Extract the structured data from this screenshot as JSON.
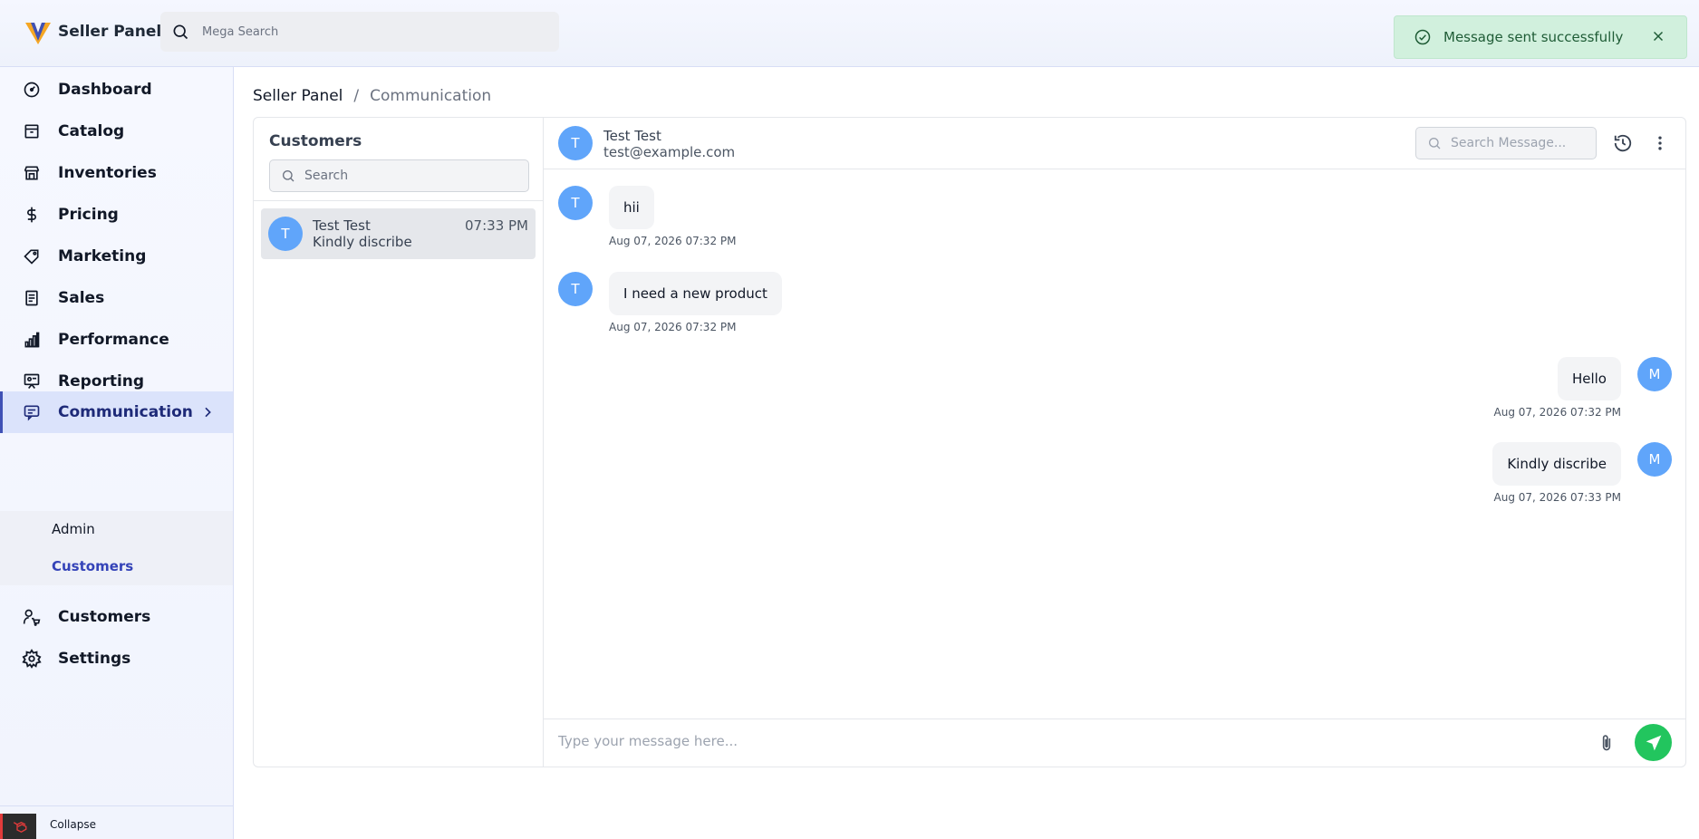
{
  "brand": {
    "name": "Seller Panel",
    "icon": "v-logo-icon"
  },
  "topbar": {
    "search_placeholder": "Mega Search",
    "search_icon": "search-icon"
  },
  "toast": {
    "message": "Message sent successfully",
    "icon": "check-circle-icon",
    "close_icon": "close-icon",
    "color": "#d1f0dd"
  },
  "sidebar": {
    "items": [
      {
        "label": "Dashboard",
        "icon": "gauge-icon"
      },
      {
        "label": "Catalog",
        "icon": "archive-box-icon"
      },
      {
        "label": "Inventories",
        "icon": "warehouse-icon"
      },
      {
        "label": "Pricing",
        "icon": "dollar-icon"
      },
      {
        "label": "Marketing",
        "icon": "tag-icon"
      },
      {
        "label": "Sales",
        "icon": "receipt-icon"
      },
      {
        "label": "Performance",
        "icon": "bar-chart-icon"
      },
      {
        "label": "Reporting",
        "icon": "presentation-icon"
      },
      {
        "label": "Communication",
        "icon": "chat-icon",
        "active": true
      },
      {
        "label": "Customers",
        "icon": "user-cart-icon"
      },
      {
        "label": "Settings",
        "icon": "gear-icon"
      }
    ],
    "submenu": [
      {
        "label": "Admin"
      },
      {
        "label": "Customers",
        "active": true
      }
    ],
    "collapse_label": "Collapse",
    "accent": "#3f51b5"
  },
  "breadcrumb": {
    "root": "Seller Panel",
    "separator": "/",
    "current": "Communication"
  },
  "customers_pane": {
    "title": "Customers",
    "search_placeholder": "Search",
    "conversations": [
      {
        "initial": "T",
        "name": "Test Test",
        "preview": "Kindly discribe",
        "time": "07:33 PM"
      }
    ]
  },
  "chat": {
    "contact": {
      "initial": "T",
      "name": "Test Test",
      "email": "test@example.com"
    },
    "search_placeholder": "Search Message...",
    "messages": [
      {
        "from": "T",
        "text": "hii",
        "time": "Aug 07, 2026 07:32 PM",
        "side": "left"
      },
      {
        "from": "T",
        "text": "I need a new product",
        "time": "Aug 07, 2026 07:32 PM",
        "side": "left"
      },
      {
        "from": "M",
        "text": "Hello",
        "time": "Aug 07, 2026 07:32 PM",
        "side": "right"
      },
      {
        "from": "M",
        "text": "Kindly discribe",
        "time": "Aug 07, 2026 07:33 PM",
        "side": "right"
      }
    ],
    "composer_placeholder": "Type your message here...",
    "send_color": "#22c55e",
    "avatar_color": "#60a5fa"
  }
}
